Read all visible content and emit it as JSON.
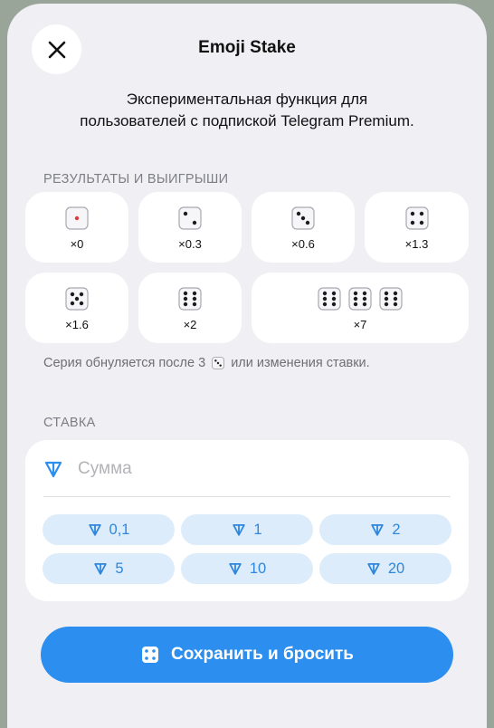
{
  "header": {
    "title": "Emoji Stake",
    "subtitle_line1": "Экспериментальная функция для",
    "subtitle_line2": "пользователей с подпиской Telegram Premium."
  },
  "results": {
    "section_label": "РЕЗУЛЬТАТЫ И ВЫИГРЫШИ",
    "tiles": [
      {
        "dice": [
          1
        ],
        "multiplier": "×0"
      },
      {
        "dice": [
          2
        ],
        "multiplier": "×0.3"
      },
      {
        "dice": [
          3
        ],
        "multiplier": "×0.6"
      },
      {
        "dice": [
          4
        ],
        "multiplier": "×1.3"
      },
      {
        "dice": [
          5
        ],
        "multiplier": "×1.6"
      },
      {
        "dice": [
          6
        ],
        "multiplier": "×2"
      },
      {
        "dice": [
          6,
          6,
          6
        ],
        "multiplier": "×7"
      }
    ],
    "note_before": "Серия обнуляется после 3",
    "note_after": "или изменения ставки."
  },
  "stake": {
    "section_label": "СТАВКА",
    "amount_placeholder": "Сумма",
    "amount_value": "",
    "chips": [
      "0,1",
      "1",
      "2",
      "5",
      "10",
      "20"
    ]
  },
  "action": {
    "button_label": "Сохранить и бросить"
  },
  "colors": {
    "accent": "#2c8eef",
    "chip_bg": "#dcecfa",
    "chip_text": "#2f86dd",
    "sheet_bg": "#efeff4"
  },
  "icons": {
    "close": "close-icon",
    "currency": "ton-icon",
    "dice": "dice-icon"
  }
}
